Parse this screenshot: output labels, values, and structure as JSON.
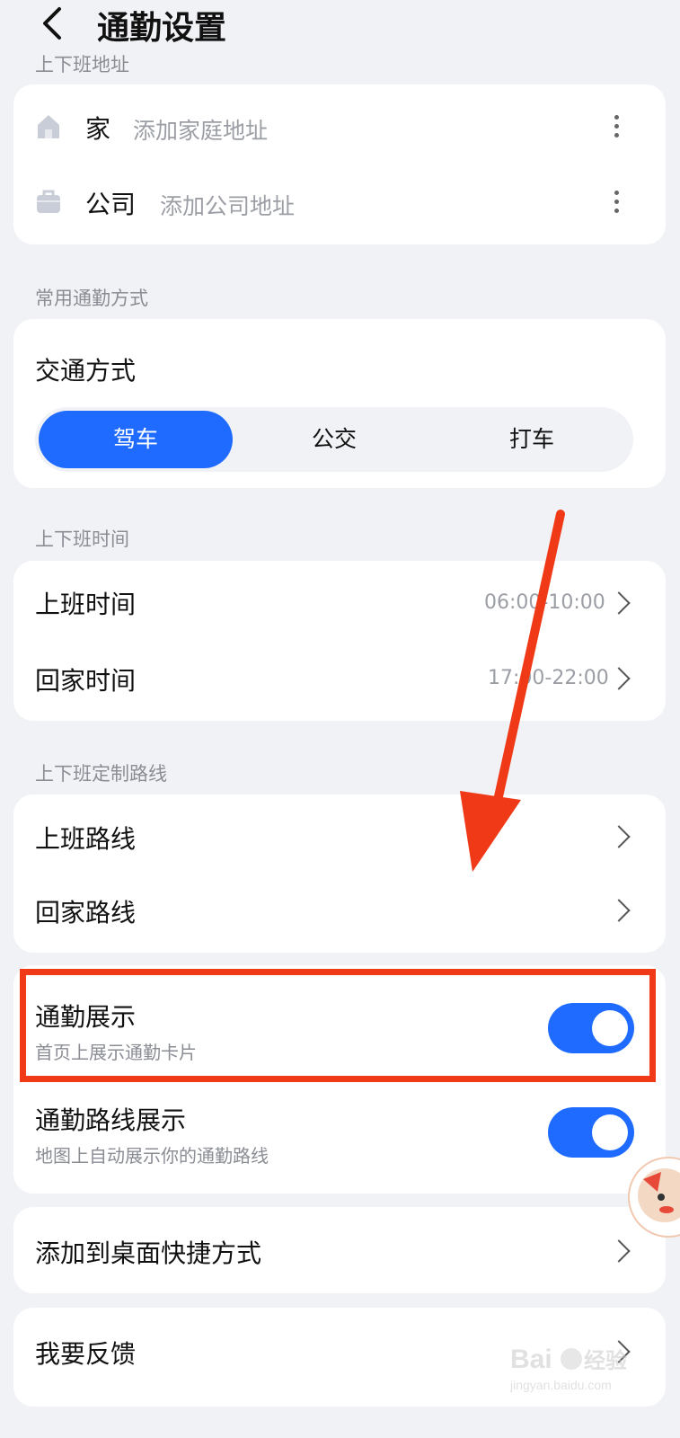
{
  "header": {
    "title": "通勤设置"
  },
  "addresses": {
    "section_label": "上下班地址",
    "home": {
      "name": "家",
      "hint": "添加家庭地址"
    },
    "work": {
      "name": "公司",
      "hint": "添加公司地址"
    }
  },
  "transport": {
    "section_label": "常用通勤方式",
    "title": "交通方式",
    "options": [
      "驾车",
      "公交",
      "打车"
    ],
    "selected": "驾车"
  },
  "times": {
    "section_label": "上下班时间",
    "go_work": {
      "label": "上班时间",
      "value": "06:00-10:00"
    },
    "go_home": {
      "label": "回家时间",
      "value": "17:00-22:00"
    }
  },
  "routes": {
    "section_label": "上下班定制路线",
    "go_work": "上班路线",
    "go_home": "回家路线"
  },
  "display": {
    "commute": {
      "title": "通勤展示",
      "subtitle": "首页上展示通勤卡片",
      "on": true
    },
    "route": {
      "title": "通勤路线展示",
      "subtitle": "地图上自动展示你的通勤路线",
      "on": true
    }
  },
  "shortcut": {
    "label": "添加到桌面快捷方式"
  },
  "feedback": {
    "label": "我要反馈"
  },
  "colors": {
    "accent": "#1f6bff",
    "annotation": "#f03a17",
    "background": "#f1f2f6"
  }
}
